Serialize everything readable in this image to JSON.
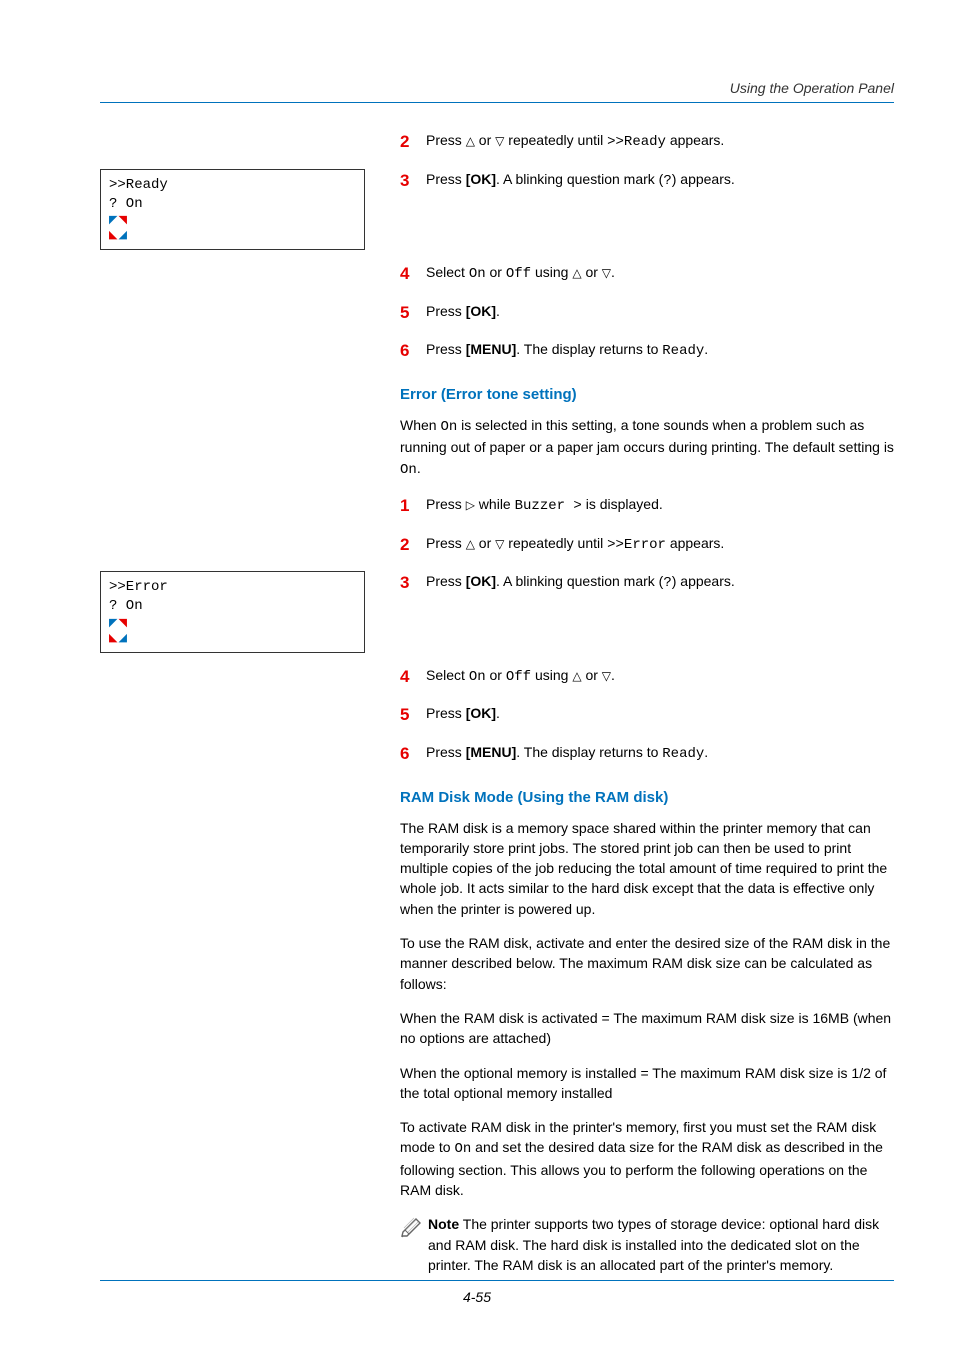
{
  "header": {
    "section": "Using the Operation Panel"
  },
  "footer": {
    "page": "4-55"
  },
  "callout1": {
    "line1": ">>Ready",
    "line2": "? On"
  },
  "callout2": {
    "line1": ">>Error",
    "line2": "? On"
  },
  "groupA": {
    "step2": {
      "pre": "Press ",
      "mid": " or ",
      "post": " repeatedly until ",
      "val": ">>Ready",
      "tail": " appears."
    },
    "step3": {
      "pre": "Press ",
      "ok": "[OK]",
      "post": ". A blinking question mark (",
      "q": "?",
      "tail": ") appears."
    },
    "step4": {
      "pre": "Select ",
      "on": "On",
      "or": " or ",
      "off": "Off",
      "post": " using ",
      "or2": " or ",
      "dot": "."
    },
    "step5": {
      "pre": "Press ",
      "ok": "[OK]",
      "dot": "."
    },
    "step6": {
      "pre": "Press ",
      "menu": "[MENU]",
      "post": ". The display returns to ",
      "ready": "Ready",
      "dot": "."
    }
  },
  "sectionError": {
    "title": "Error (Error tone setting)",
    "intro": {
      "pre": "When ",
      "on": "On",
      "post": " is selected in this setting, a tone sounds when a problem such as running out of paper or a paper jam occurs during printing. The default setting is ",
      "on2": "On",
      "dot": "."
    },
    "step1": {
      "pre": "Press ",
      "post": " while ",
      "val": "Buzzer >",
      "tail": " is displayed."
    },
    "step2": {
      "pre": "Press ",
      "mid": " or ",
      "post": " repeatedly until ",
      "val": ">>Error",
      "tail": " appears."
    },
    "step3": {
      "pre": "Press ",
      "ok": "[OK]",
      "post": ". A blinking question mark (",
      "q": "?",
      "tail": ") appears."
    },
    "step4": {
      "pre": "Select ",
      "on": "On",
      "or": " or ",
      "off": "Off",
      "post": " using ",
      "or2": " or ",
      "dot": "."
    },
    "step5": {
      "pre": "Press ",
      "ok": "[OK]",
      "dot": "."
    },
    "step6": {
      "pre": "Press ",
      "menu": "[MENU]",
      "post": ". The display returns to ",
      "ready": "Ready",
      "dot": "."
    }
  },
  "sectionRAM": {
    "title": "RAM Disk Mode (Using the RAM disk)",
    "p1": "The RAM disk is a memory space shared within the printer memory that can temporarily store print jobs. The stored print job can then be used to print multiple copies of the job reducing the total amount of time required to print the whole job. It acts similar to the hard disk except that the data is effective only when the printer is powered up.",
    "p2": "To use the RAM disk, activate and enter the desired size of the RAM disk in the manner described below. The maximum RAM disk size can be calculated as follows:",
    "p3": "When the RAM disk is activated = The maximum RAM disk size is 16MB (when no options are attached)",
    "p4": "When the optional memory is installed = The maximum RAM disk size is 1/2 of the total optional memory installed",
    "p5": {
      "pre": "To activate RAM disk in the printer's memory, first you must set the RAM disk mode to ",
      "on": "On",
      "post": " and set the desired data size for the RAM disk as described in the following section. This allows you to perform the following operations on the RAM disk."
    },
    "note": {
      "bold": "Note",
      "body": "  The printer supports two types of storage device: optional hard disk and RAM disk. The hard disk is installed into the dedicated slot on the printer. The RAM disk is an allocated part of the printer's memory."
    }
  }
}
